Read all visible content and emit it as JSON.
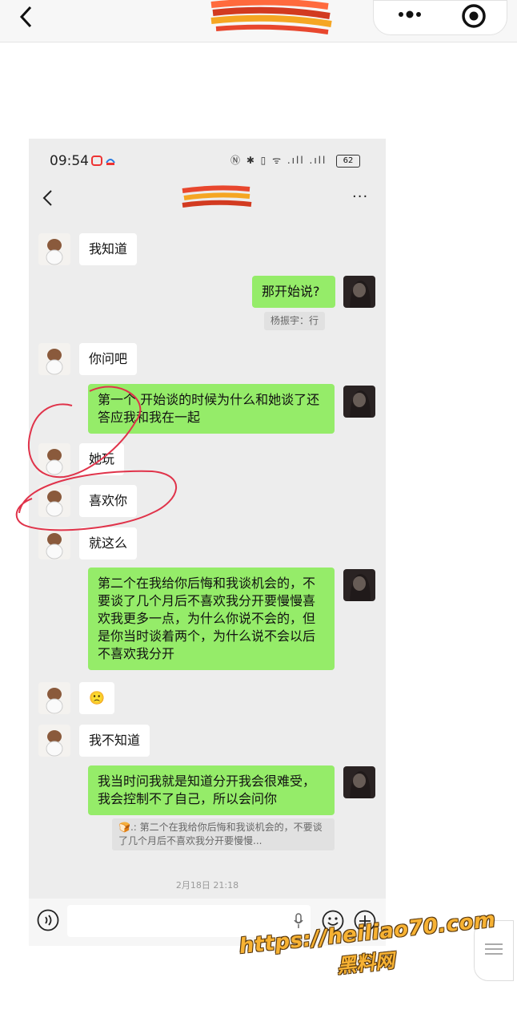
{
  "outer": {
    "back_icon": "chevron-left-icon",
    "more_icon": "more-dots-icon",
    "target_icon": "target-icon"
  },
  "phone": {
    "status": {
      "time": "09:54",
      "icons": "Ⓝ ✱ ▯ ᯤ .ıll .ıll",
      "battery": "62"
    },
    "header": {
      "more": "···"
    },
    "messages": [
      {
        "side": "left",
        "text": "我知道"
      },
      {
        "side": "right",
        "text": "那开始说?"
      },
      {
        "side": "left",
        "text": "你问吧"
      },
      {
        "side": "right",
        "text": "第一个  开始谈的时候为什么和她谈了还答应我和我在一起"
      },
      {
        "side": "left",
        "text": "她玩"
      },
      {
        "side": "left",
        "text": "喜欢你"
      },
      {
        "side": "left",
        "text": "就这么"
      },
      {
        "side": "right",
        "text": "第二个在我给你后悔和我谈机会的，不要谈了几个月后不喜欢我分开要慢慢喜欢我更多一点，为什么你说不会的，但是你当时谈着两个，为什么说不会以后不喜欢我分开"
      },
      {
        "side": "left",
        "text": "🙁"
      },
      {
        "side": "left",
        "text": "我不知道"
      },
      {
        "side": "right",
        "text": "我当时问我就是知道分开我会很难受，我会控制不了自己，所以会问你"
      }
    ],
    "quote_1": "杨振宇：行",
    "quote_2": "🍞.: 第二个在我给你后悔和我谈机会的，不要谈了几个月后不喜欢我分开要慢慢...",
    "timestamp": "2月18日 21:18"
  },
  "watermark": {
    "url": "https://heiliao70.com",
    "name": "黑料网"
  },
  "colors": {
    "bubble_right": "#95ec69",
    "bubble_left": "#ffffff",
    "chat_bg": "#ededed",
    "annotation_red": "#e0334a",
    "watermark": "#f7b233"
  }
}
